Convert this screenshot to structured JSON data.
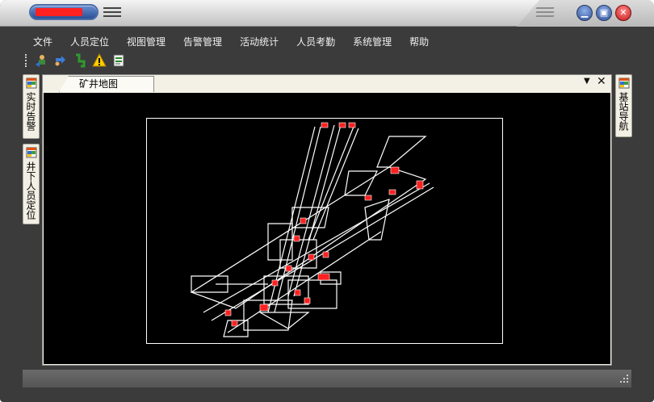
{
  "window": {
    "title_redacted": true,
    "controls": [
      "minimize",
      "maximize",
      "close"
    ]
  },
  "menu": {
    "items": [
      "文件",
      "人员定位",
      "视图管理",
      "告警管理",
      "活动统计",
      "人员考勤",
      "系统管理",
      "帮助"
    ]
  },
  "toolbar": {
    "icons": [
      "person-locate-icon",
      "swap-icon",
      "route-icon",
      "warning-icon",
      "report-icon"
    ]
  },
  "left_dock": {
    "tabs": [
      {
        "label": "实时告警",
        "icon": "window-icon"
      },
      {
        "label": "井下人员定位",
        "icon": "window-icon"
      }
    ]
  },
  "right_dock": {
    "tabs": [
      {
        "label": "基站导航",
        "icon": "window-icon"
      }
    ]
  },
  "document": {
    "tab_label": "矿井地图",
    "dropdown_glyph": "▼",
    "close_glyph": "✕"
  },
  "colors": {
    "window_bg": "#3b3b3b",
    "map_bg": "#000000",
    "map_lines": "#ffffff",
    "station_markers": "#ff2020",
    "dock_bg": "#f2efe4"
  }
}
